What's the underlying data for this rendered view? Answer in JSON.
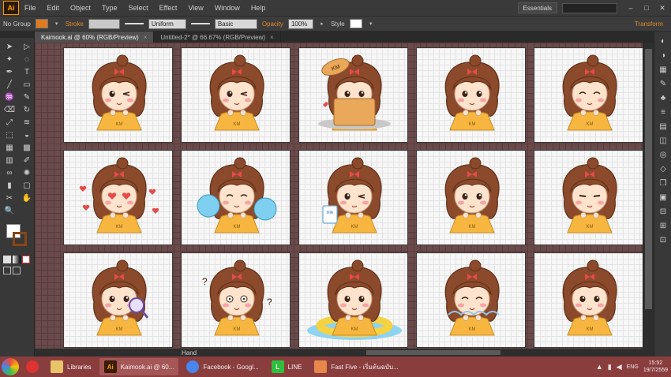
{
  "app": {
    "logo_text": "Ai",
    "menu": [
      "File",
      "Edit",
      "Object",
      "Type",
      "Select",
      "Effect",
      "View",
      "Window",
      "Help"
    ],
    "workspace": "Essentials",
    "window_controls": [
      "–",
      "□",
      "✕"
    ]
  },
  "control_bar": {
    "selection_label": "No Group",
    "stroke_label": "Stroke",
    "profile_value": "Uniform",
    "brush_value": "Basic",
    "opacity_label": "Opacity",
    "opacity_value": "100%",
    "style_label": "Style",
    "transform_label": "Transform",
    "colors": {
      "fill": "#e07b1f",
      "stroke": "#c8c8c8",
      "style": "#ffffff"
    }
  },
  "tabs": [
    {
      "label": "Kaimook.ai @ 60% (RGB/Preview)",
      "close": "×",
      "active": true
    },
    {
      "label": "Untitled-2* @ 66.67% (RGB/Preview)",
      "close": "×",
      "active": false
    }
  ],
  "tools": {
    "icons": [
      "selection-icon",
      "direct-selection-icon",
      "magic-wand-icon",
      "lasso-icon",
      "pen-icon",
      "type-icon",
      "line-icon",
      "rectangle-icon",
      "paintbrush-icon",
      "pencil-icon",
      "eraser-icon",
      "rotate-icon",
      "scale-icon",
      "width-icon",
      "free-transform-icon",
      "shape-builder-icon",
      "perspective-icon",
      "mesh-icon",
      "gradient-icon",
      "eyedropper-icon",
      "blend-icon",
      "symbol-sprayer-icon",
      "graph-icon",
      "artboard-icon",
      "slice-icon",
      "hand-icon",
      "zoom-icon"
    ],
    "glyphs": [
      "➤",
      "▷",
      "✦",
      "◌",
      "✒",
      "T",
      "╱",
      "▭",
      "♒",
      "✎",
      "⌫",
      "↻",
      "⤢",
      "≋",
      "⬚",
      "◒",
      "▦",
      "▩",
      "▥",
      "✐",
      "∞",
      "✺",
      "▮",
      "▢",
      "✂",
      "✋",
      "🔍"
    ],
    "fill_color": "#ffffff",
    "stroke_color": "#8b4513"
  },
  "right_panel": {
    "icons": [
      "color-icon",
      "color-guide-icon",
      "swatches-icon",
      "brushes-icon",
      "symbols-icon",
      "stroke-icon",
      "gradient-icon",
      "transparency-icon",
      "appearance-icon",
      "graphic-styles-icon",
      "layers-icon",
      "artboards-icon",
      "align-icon",
      "pathfinder-icon",
      "transform-icon"
    ],
    "glyphs": [
      "◐",
      "◑",
      "▦",
      "✎",
      "♣",
      "≡",
      "▤",
      "◫",
      "◎",
      "◇",
      "❐",
      "▣",
      "⊟",
      "⊞",
      "⊡"
    ]
  },
  "status": {
    "tool": "Hand"
  },
  "artboards": [
    {
      "name": "sticker-wink-thumbsup"
    },
    {
      "name": "sticker-v-sign-wink"
    },
    {
      "name": "sticker-in-box-surprise",
      "box_label": "KM"
    },
    {
      "name": "sticker-hands-together"
    },
    {
      "name": "sticker-laughing"
    },
    {
      "name": "sticker-heart-eyes"
    },
    {
      "name": "sticker-cheerleader"
    },
    {
      "name": "sticker-milk",
      "cup_label": "Milk"
    },
    {
      "name": "sticker-shy-drink"
    },
    {
      "name": "sticker-annoyed"
    },
    {
      "name": "sticker-magnifier"
    },
    {
      "name": "sticker-confused"
    },
    {
      "name": "sticker-swim-ring"
    },
    {
      "name": "sticker-sleepy"
    },
    {
      "name": "sticker-blush"
    }
  ],
  "shirt_label": "KM",
  "colors": {
    "hair": "#8b4a2b",
    "hair_dark": "#5e2e18",
    "skin": "#ffe3cc",
    "cheek": "#f7a3a3",
    "shirt": "#f6b640",
    "bow": "#e84a4a",
    "pom": "#7fd0f0",
    "ring": "#f5d240",
    "water": "#8fd3f2",
    "box": "#e9a85a"
  },
  "taskbar": {
    "items": [
      {
        "label": "Libraries",
        "icon": "folder-icon",
        "color": "#e8c36a",
        "active": false
      },
      {
        "label": "Kaimook.ai @ 60...",
        "icon": "illustrator-icon",
        "color": "#3b1c06",
        "active": true
      },
      {
        "label": "Facebook - Googl...",
        "icon": "chrome-icon",
        "color": "#4885ed",
        "active": false
      },
      {
        "label": "LINE",
        "icon": "line-icon",
        "color": "#2fbf3f",
        "active": false
      },
      {
        "label": "Fast Five - เริ่มต้นฉบับ...",
        "icon": "paint-icon",
        "color": "#e8874a",
        "active": false
      }
    ],
    "icon_text": {
      "illustrator": "Ai",
      "line": "L"
    },
    "lang": "ENG",
    "time": "15:52",
    "date": "19/7/2559"
  }
}
